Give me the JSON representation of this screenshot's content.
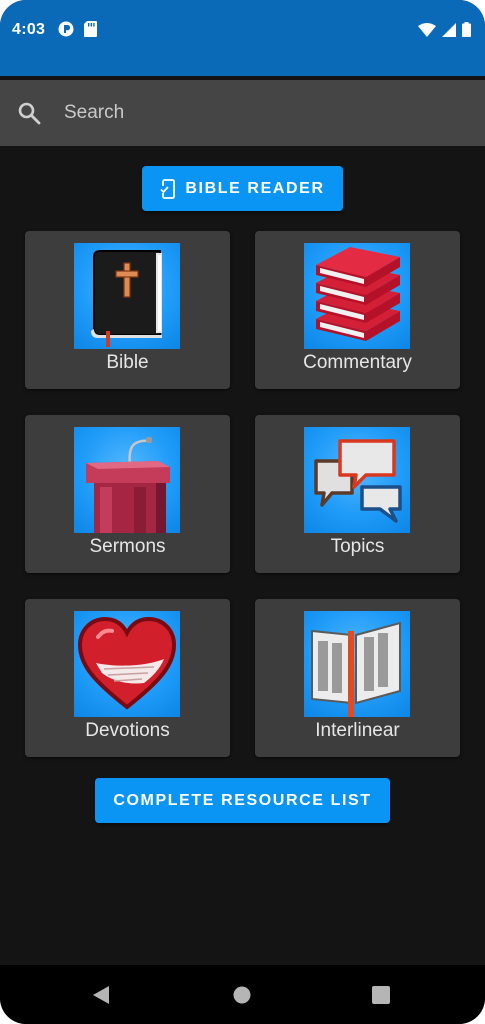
{
  "status_bar": {
    "time": "4:03",
    "background": "#0a6ab8",
    "icons": [
      "notification-app-icon",
      "sd-card-icon",
      "wifi-icon",
      "cell-signal-icon",
      "battery-icon"
    ]
  },
  "search": {
    "placeholder": "Search",
    "value": "",
    "icon": "search-icon"
  },
  "actions": {
    "bible_reader_label": "BIBLE READER",
    "bible_reader_icon": "phone-check-icon",
    "complete_resource_label": "COMPLETE RESOURCE LIST",
    "accent": "#0a95f5"
  },
  "tiles": [
    {
      "label": "Bible",
      "icon": "bible-book-icon"
    },
    {
      "label": "Commentary",
      "icon": "book-stack-icon"
    },
    {
      "label": "Sermons",
      "icon": "pulpit-icon"
    },
    {
      "label": "Topics",
      "icon": "speech-bubbles-icon"
    },
    {
      "label": "Devotions",
      "icon": "heart-icon"
    },
    {
      "label": "Interlinear",
      "icon": "open-book-icon"
    }
  ],
  "nav_bar": {
    "buttons": [
      "back-icon",
      "home-icon",
      "recents-icon"
    ]
  }
}
